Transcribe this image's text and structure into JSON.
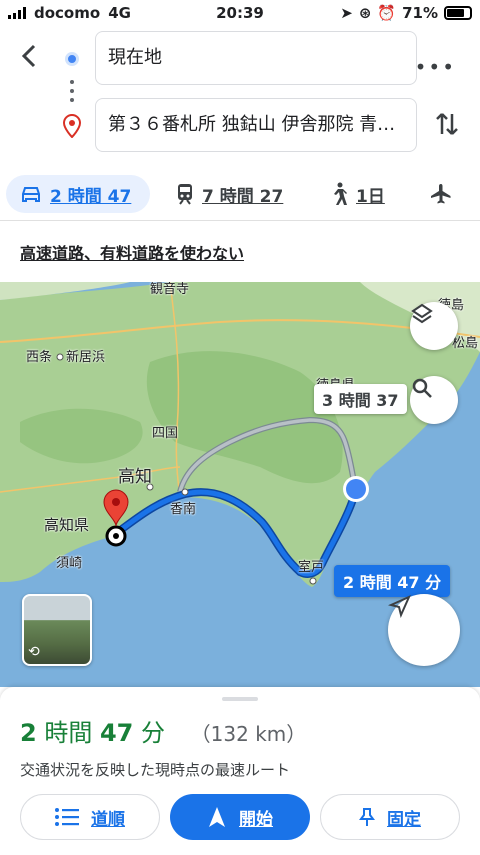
{
  "status_bar": {
    "carrier": "docomo",
    "network": "4G",
    "time": "20:39",
    "battery": "71%"
  },
  "directions": {
    "origin": "現在地",
    "destination": "第３６番札所 独鈷山 伊舎那院 青…"
  },
  "modes": [
    {
      "icon": "car-icon",
      "label": "2 時間 47",
      "active": true
    },
    {
      "icon": "train-icon",
      "label": "7 時間 27",
      "active": false
    },
    {
      "icon": "walk-icon",
      "label": "1日",
      "active": false
    },
    {
      "icon": "plane-icon",
      "label": "",
      "active": false
    }
  ],
  "route_option": "高速道路、有料道路を使わない",
  "map": {
    "labels": {
      "kannonji": "観音寺",
      "saijo": "西条",
      "niihama": "新居浜",
      "tokushima_pref": "徳島県",
      "tokushima": "徳島",
      "matsushima": "松島",
      "shikoku": "四国",
      "kochi": "高知",
      "kochi_pref": "高知県",
      "susaki": "須崎",
      "konan": "香南",
      "muroto": "室戸"
    },
    "alt_route_label": "3 時間 37",
    "main_route_label": "2 時間 47 分",
    "colors": {
      "route": "#1a73e8",
      "alt_route": "#9aa0a6",
      "sea": "#7bb0dc",
      "land": "#a9cf94"
    }
  },
  "sheet": {
    "duration_prefix_num1": "2",
    "duration_unit1": "時間",
    "duration_num2": "47",
    "duration_unit2": "分",
    "distance": "（132 km）",
    "subtitle": "交通状況を反映した現時点の最速ルート",
    "buttons": {
      "steps": "道順",
      "start": "開始",
      "pin": "固定"
    }
  }
}
